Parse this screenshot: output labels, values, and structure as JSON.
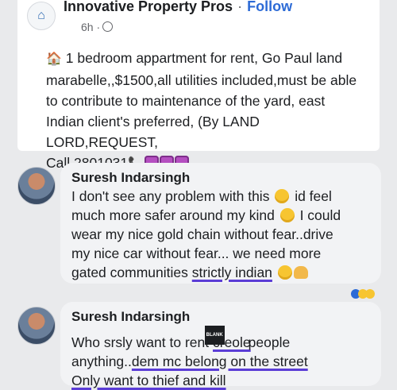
{
  "post": {
    "page_name": "Innovative Property Pros",
    "separator": "·",
    "follow_label": "Follow",
    "time": "6h ·",
    "line1": "1 bedroom appartment for rent, Go Paul land",
    "line2": "marabelle,,$1500,all utilities included,must be able",
    "line3": "to contribute to maintenance of the  yard, east",
    "line4": "Indian  client's preferred, (By LAND LORD,REQUEST,",
    "line5": "Call 2801031"
  },
  "comments": [
    {
      "author": "Suresh Indarsingh",
      "l1a": "I don't see any problem with this",
      "l1b": "id feel",
      "l2a": "much more safer around my kind",
      "l2b": "I could",
      "l3": "wear my nice gold chain without fear..drive",
      "l4": "my nice car without fear... we need more",
      "l5a": "gated communities",
      "l5b": "strictly indian"
    },
    {
      "author": "Suresh Indarsingh",
      "l1a": "Who srsly want to rent",
      "l1b": "creole",
      "l1c": "people",
      "tag": "BLANK",
      "l2a": "anything..",
      "l2b": "dem mc belong on the street",
      "l3": "Only want to thief and kill"
    }
  ],
  "icons": {
    "house": "🏠",
    "phone": "📞"
  },
  "colors": {
    "follow": "#2d6bd6",
    "underline": "#5b3dd6",
    "bubble": "#f2f3f5"
  }
}
